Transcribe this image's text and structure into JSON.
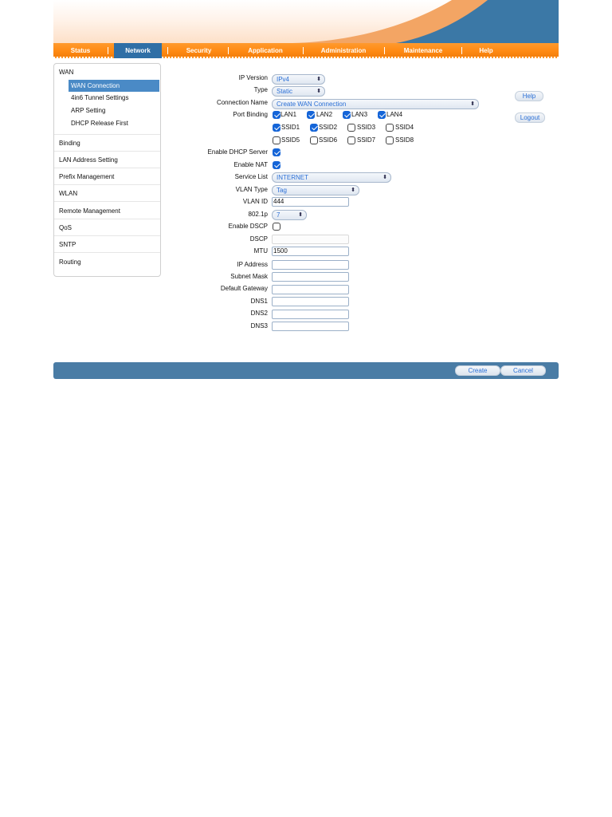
{
  "nav": {
    "items": [
      "Status",
      "Network",
      "Security",
      "Application",
      "Administration",
      "Maintenance",
      "Help"
    ],
    "active": "Network"
  },
  "sidebar": {
    "wan": "WAN",
    "wan_sub": [
      "WAN Connection",
      "4in6 Tunnel Settings",
      "ARP Setting",
      "DHCP Release First"
    ],
    "items": [
      "Binding",
      "LAN Address Setting",
      "Prefix Management",
      "WLAN",
      "Remote Management",
      "QoS",
      "SNTP",
      "Routing"
    ]
  },
  "form": {
    "ip_version": {
      "label": "IP Version",
      "value": "IPv4"
    },
    "type": {
      "label": "Type",
      "value": "Static"
    },
    "connection_name": {
      "label": "Connection Name",
      "value": "Create WAN Connection"
    },
    "port_binding": {
      "label": "Port Binding",
      "ports": [
        {
          "name": "LAN1",
          "checked": true
        },
        {
          "name": "LAN2",
          "checked": true
        },
        {
          "name": "LAN3",
          "checked": true
        },
        {
          "name": "LAN4",
          "checked": true
        },
        {
          "name": "SSID1",
          "checked": true
        },
        {
          "name": "SSID2",
          "checked": true
        },
        {
          "name": "SSID3",
          "checked": false
        },
        {
          "name": "SSID4",
          "checked": false
        },
        {
          "name": "SSID5",
          "checked": false
        },
        {
          "name": "SSID6",
          "checked": false
        },
        {
          "name": "SSID7",
          "checked": false
        },
        {
          "name": "SSID8",
          "checked": false
        }
      ]
    },
    "enable_dhcp_server": {
      "label": "Enable DHCP Server",
      "checked": true
    },
    "enable_nat": {
      "label": "Enable NAT",
      "checked": true
    },
    "service_list": {
      "label": "Service List",
      "value": "INTERNET"
    },
    "vlan_type": {
      "label": "VLAN Type",
      "value": "Tag"
    },
    "vlan_id": {
      "label": "VLAN ID",
      "value": "444"
    },
    "dot1p": {
      "label": "802.1p",
      "value": "7"
    },
    "enable_dscp": {
      "label": "Enable DSCP",
      "checked": false
    },
    "dscp": {
      "label": "DSCP",
      "value": ""
    },
    "mtu": {
      "label": "MTU",
      "value": "1500"
    },
    "ip_address": {
      "label": "IP Address",
      "value": ""
    },
    "subnet_mask": {
      "label": "Subnet Mask",
      "value": ""
    },
    "default_gateway": {
      "label": "Default Gateway",
      "value": ""
    },
    "dns1": {
      "label": "DNS1",
      "value": ""
    },
    "dns2": {
      "label": "DNS2",
      "value": ""
    },
    "dns3": {
      "label": "DNS3",
      "value": ""
    }
  },
  "side_buttons": {
    "help": "Help",
    "logout": "Logout"
  },
  "footer": {
    "create": "Create",
    "cancel": "Cancel"
  },
  "colors": {
    "nav_orange": "#ff8a12",
    "nav_active": "#2f6fa6",
    "footer_bar": "#4a7ca5",
    "check_blue": "#1565d8"
  }
}
